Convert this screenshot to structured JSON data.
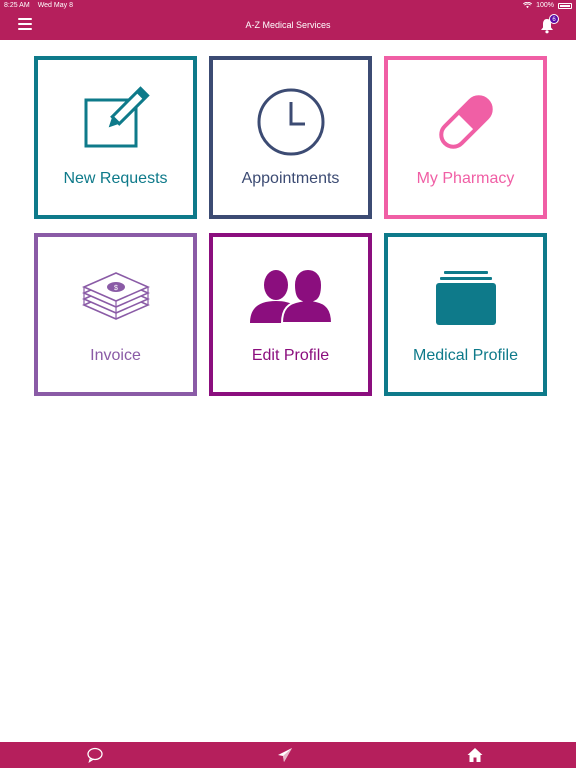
{
  "status_bar": {
    "time": "8:25 AM",
    "date": "Wed May 8",
    "battery": "100%"
  },
  "header": {
    "title": "A-Z Medical Services",
    "notification_count": "6",
    "menu_icon": "hamburger-menu-icon",
    "bell_icon": "bell-icon"
  },
  "tiles": [
    {
      "label": "New Requests",
      "icon": "edit-pencil-icon",
      "color": "#0e7a8a"
    },
    {
      "label": "Appointments",
      "icon": "clock-icon",
      "color": "#3c4b73"
    },
    {
      "label": "My Pharmacy",
      "icon": "pill-capsule-icon",
      "color": "#f05fa5"
    },
    {
      "label": "Invoice",
      "icon": "money-stack-icon",
      "color": "#8a5ba6"
    },
    {
      "label": "Edit Profile",
      "icon": "users-icon",
      "color": "#8b0e7e"
    },
    {
      "label": "Medical Profile",
      "icon": "folder-stack-icon",
      "color": "#0e7a8a"
    }
  ],
  "bottom_tabs": [
    {
      "name": "chat",
      "icon": "chat-bubble-icon"
    },
    {
      "name": "send",
      "icon": "paper-plane-icon"
    },
    {
      "name": "home",
      "icon": "home-icon"
    }
  ],
  "colors": {
    "brand": "#b51f5c",
    "badge": "#5b0aa6"
  }
}
